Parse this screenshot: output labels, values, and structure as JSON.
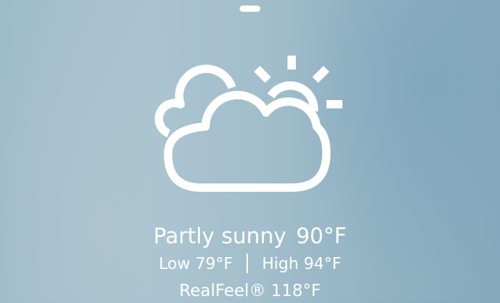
{
  "weather": {
    "icon": "partly-sunny-icon",
    "condition": "Partly sunny",
    "temperature": "90°F",
    "low": "Low 79°F",
    "high": "High 94°F",
    "realfeel": "RealFeel® 118°F"
  },
  "colors": {
    "text": "#ffffff",
    "background": "#a3bfcc"
  }
}
